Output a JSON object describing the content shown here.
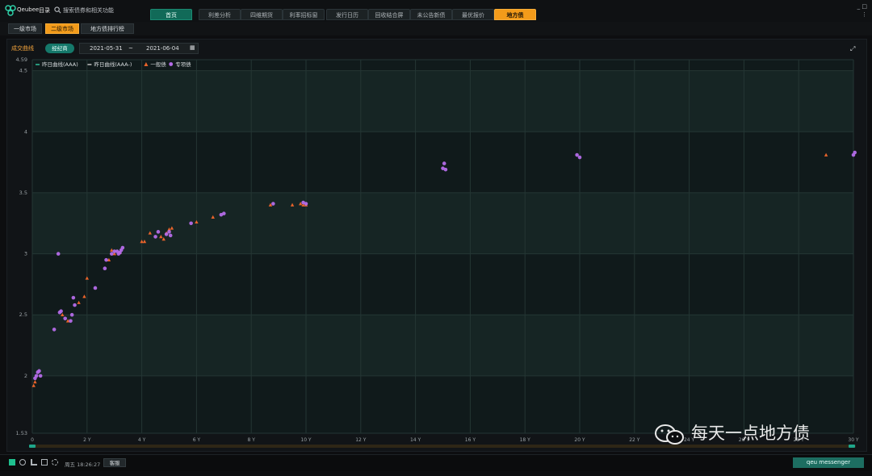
{
  "app": {
    "brand": "Qeubee",
    "jump": "目录",
    "search_placeholder": "搜索债券和相关功能"
  },
  "main_tabs": [
    {
      "label": "首页"
    },
    {
      "label": "利差分析"
    },
    {
      "label": "四维期货"
    },
    {
      "label": "利率招标窗"
    },
    {
      "label": "发行日历"
    },
    {
      "label": "回收结合屏"
    },
    {
      "label": "未公告新债"
    },
    {
      "label": "最优报价"
    },
    {
      "label": "地方债"
    }
  ],
  "sub_tabs": [
    {
      "label": "一级市场"
    },
    {
      "label": "二级市场"
    },
    {
      "label": "地方债排行榜"
    }
  ],
  "panel": {
    "title": "成交曲线",
    "pill": "经纪商",
    "date_from": "2021-05-31",
    "date_sep": "~",
    "date_to": "2021-06-04"
  },
  "status": {
    "time": "周五 18:26:27",
    "button": "客服",
    "messenger": "qeu messenger"
  },
  "watermark": "每天一点地方债",
  "colors": {
    "accent": "#f39b1a",
    "teal": "#15786a",
    "purple": "#b46be8",
    "orange": "#e8632a"
  },
  "chart_data": {
    "type": "scatter",
    "x_tick_labels": [
      "0",
      "2 Y",
      "4 Y",
      "6 Y",
      "8 Y",
      "10 Y",
      "12 Y",
      "14 Y",
      "16 Y",
      "18 Y",
      "20 Y",
      "22 Y",
      "24 Y",
      "26 Y",
      "28 Y",
      "30 Y"
    ],
    "x_ticks": [
      0,
      2,
      4,
      6,
      8,
      10,
      12,
      14,
      16,
      18,
      20,
      22,
      24,
      26,
      28,
      30
    ],
    "y_ticks": [
      1.53,
      2,
      2.5,
      3,
      3.5,
      4,
      4.5,
      4.59
    ],
    "xlim": [
      0,
      30
    ],
    "ylim": [
      1.53,
      4.59
    ],
    "grid": true,
    "legend_position": "top-left",
    "series": [
      {
        "name": "昨日曲线(AAA)",
        "kind": "line",
        "color": "#2fbf9b",
        "points": []
      },
      {
        "name": "昨日曲线(AAA-)",
        "kind": "line",
        "color": "#c0c0c0",
        "points": []
      },
      {
        "name": "一般债",
        "kind": "triangle",
        "color": "#e8632a",
        "points": [
          [
            0.05,
            1.92
          ],
          [
            0.1,
            1.95
          ],
          [
            1.1,
            2.5
          ],
          [
            1.3,
            2.45
          ],
          [
            1.7,
            2.6
          ],
          [
            1.9,
            2.65
          ],
          [
            2.0,
            2.8
          ],
          [
            2.8,
            2.95
          ],
          [
            2.9,
            3.03
          ],
          [
            3.0,
            3.0
          ],
          [
            3.2,
            3.01
          ],
          [
            4.0,
            3.1
          ],
          [
            4.1,
            3.1
          ],
          [
            4.3,
            3.17
          ],
          [
            4.7,
            3.14
          ],
          [
            4.8,
            3.12
          ],
          [
            4.9,
            3.17
          ],
          [
            5.0,
            3.2
          ],
          [
            5.1,
            3.21
          ],
          [
            6.0,
            3.26
          ],
          [
            6.6,
            3.3
          ],
          [
            8.7,
            3.4
          ],
          [
            9.5,
            3.4
          ],
          [
            9.8,
            3.41
          ],
          [
            9.9,
            3.4
          ],
          [
            10.0,
            3.4
          ],
          [
            29.0,
            3.81
          ]
        ]
      },
      {
        "name": "专项债",
        "kind": "circle",
        "color": "#b46be8",
        "points": [
          [
            0.1,
            1.98
          ],
          [
            0.15,
            2.0
          ],
          [
            0.2,
            2.03
          ],
          [
            0.25,
            2.04
          ],
          [
            0.3,
            2.0
          ],
          [
            0.8,
            2.38
          ],
          [
            0.95,
            3.0
          ],
          [
            1.0,
            2.52
          ],
          [
            1.05,
            2.53
          ],
          [
            1.2,
            2.47
          ],
          [
            1.4,
            2.45
          ],
          [
            1.45,
            2.5
          ],
          [
            1.5,
            2.64
          ],
          [
            1.55,
            2.58
          ],
          [
            2.3,
            2.72
          ],
          [
            2.65,
            2.88
          ],
          [
            2.7,
            2.95
          ],
          [
            2.9,
            3.0
          ],
          [
            3.0,
            3.02
          ],
          [
            3.1,
            3.02
          ],
          [
            3.15,
            3.0
          ],
          [
            3.2,
            3.01
          ],
          [
            3.25,
            3.03
          ],
          [
            3.3,
            3.05
          ],
          [
            4.5,
            3.14
          ],
          [
            4.6,
            3.18
          ],
          [
            4.9,
            3.16
          ],
          [
            5.0,
            3.18
          ],
          [
            5.05,
            3.15
          ],
          [
            5.8,
            3.25
          ],
          [
            6.9,
            3.32
          ],
          [
            7.0,
            3.33
          ],
          [
            8.8,
            3.41
          ],
          [
            9.9,
            3.42
          ],
          [
            10.0,
            3.41
          ],
          [
            15.0,
            3.7
          ],
          [
            15.1,
            3.69
          ],
          [
            15.05,
            3.74
          ],
          [
            19.9,
            3.81
          ],
          [
            20.0,
            3.79
          ],
          [
            30.0,
            3.81
          ],
          [
            30.05,
            3.83
          ]
        ]
      }
    ]
  }
}
